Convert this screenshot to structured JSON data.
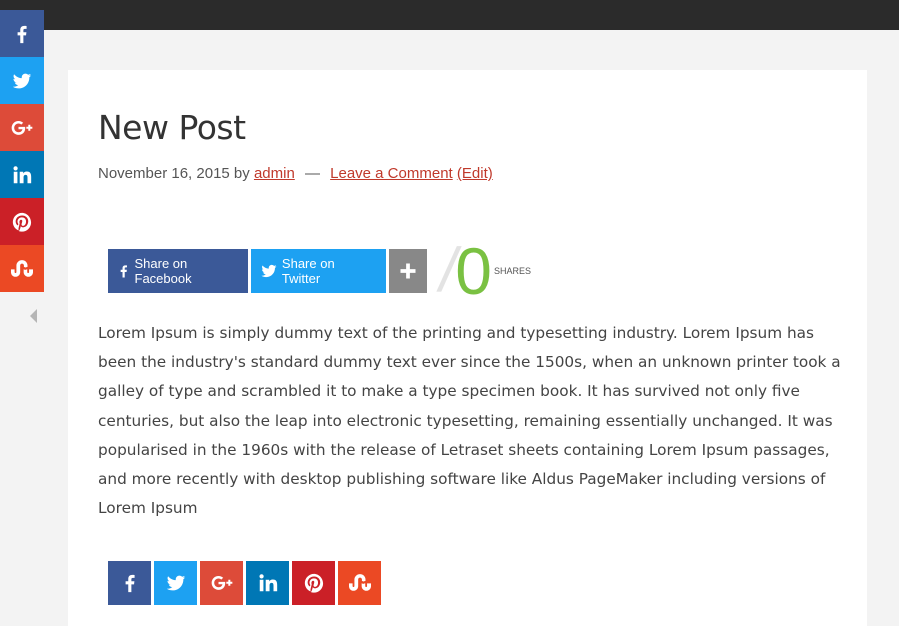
{
  "post": {
    "title": "New Post",
    "date": "November 16, 2015",
    "by": "by",
    "author": "admin",
    "dash": "—",
    "comment_link": "Leave a Comment",
    "edit_link": "(Edit)",
    "body": "Lorem Ipsum is simply dummy text of the printing and typesetting industry. Lorem Ipsum has been the industry's standard dummy text ever since the 1500s, when an unknown printer took a galley of type and scrambled it to make a type specimen book. It has survived not only five centuries, but also the leap into electronic typesetting, remaining essentially unchanged. It was popularised in the 1960s with the release of Letraset sheets containing Lorem Ipsum passages, and more recently with desktop publishing software like Aldus PageMaker including versions of Lorem Ipsum"
  },
  "share_bar": {
    "facebook_label": "Share on Facebook",
    "twitter_label": "Share on Twitter",
    "slash": "/",
    "count": "0",
    "count_label": "SHARES"
  },
  "side_share": {
    "items": [
      {
        "network": "facebook",
        "icon": "facebook-icon",
        "color": "#3b5998"
      },
      {
        "network": "twitter",
        "icon": "twitter-icon",
        "color": "#1da1f2"
      },
      {
        "network": "google-plus",
        "icon": "google-plus-icon",
        "color": "#dd4b39"
      },
      {
        "network": "linkedin",
        "icon": "linkedin-icon",
        "color": "#0077b5"
      },
      {
        "network": "pinterest",
        "icon": "pinterest-icon",
        "color": "#cb2027"
      },
      {
        "network": "stumbleupon",
        "icon": "stumbleupon-icon",
        "color": "#eb4924"
      }
    ]
  },
  "colors": {
    "topbar": "#2b2b2b",
    "page_bg": "#f3f3f3",
    "link": "#c0392b",
    "count_green": "#7ac142",
    "more_button": "#888888"
  }
}
